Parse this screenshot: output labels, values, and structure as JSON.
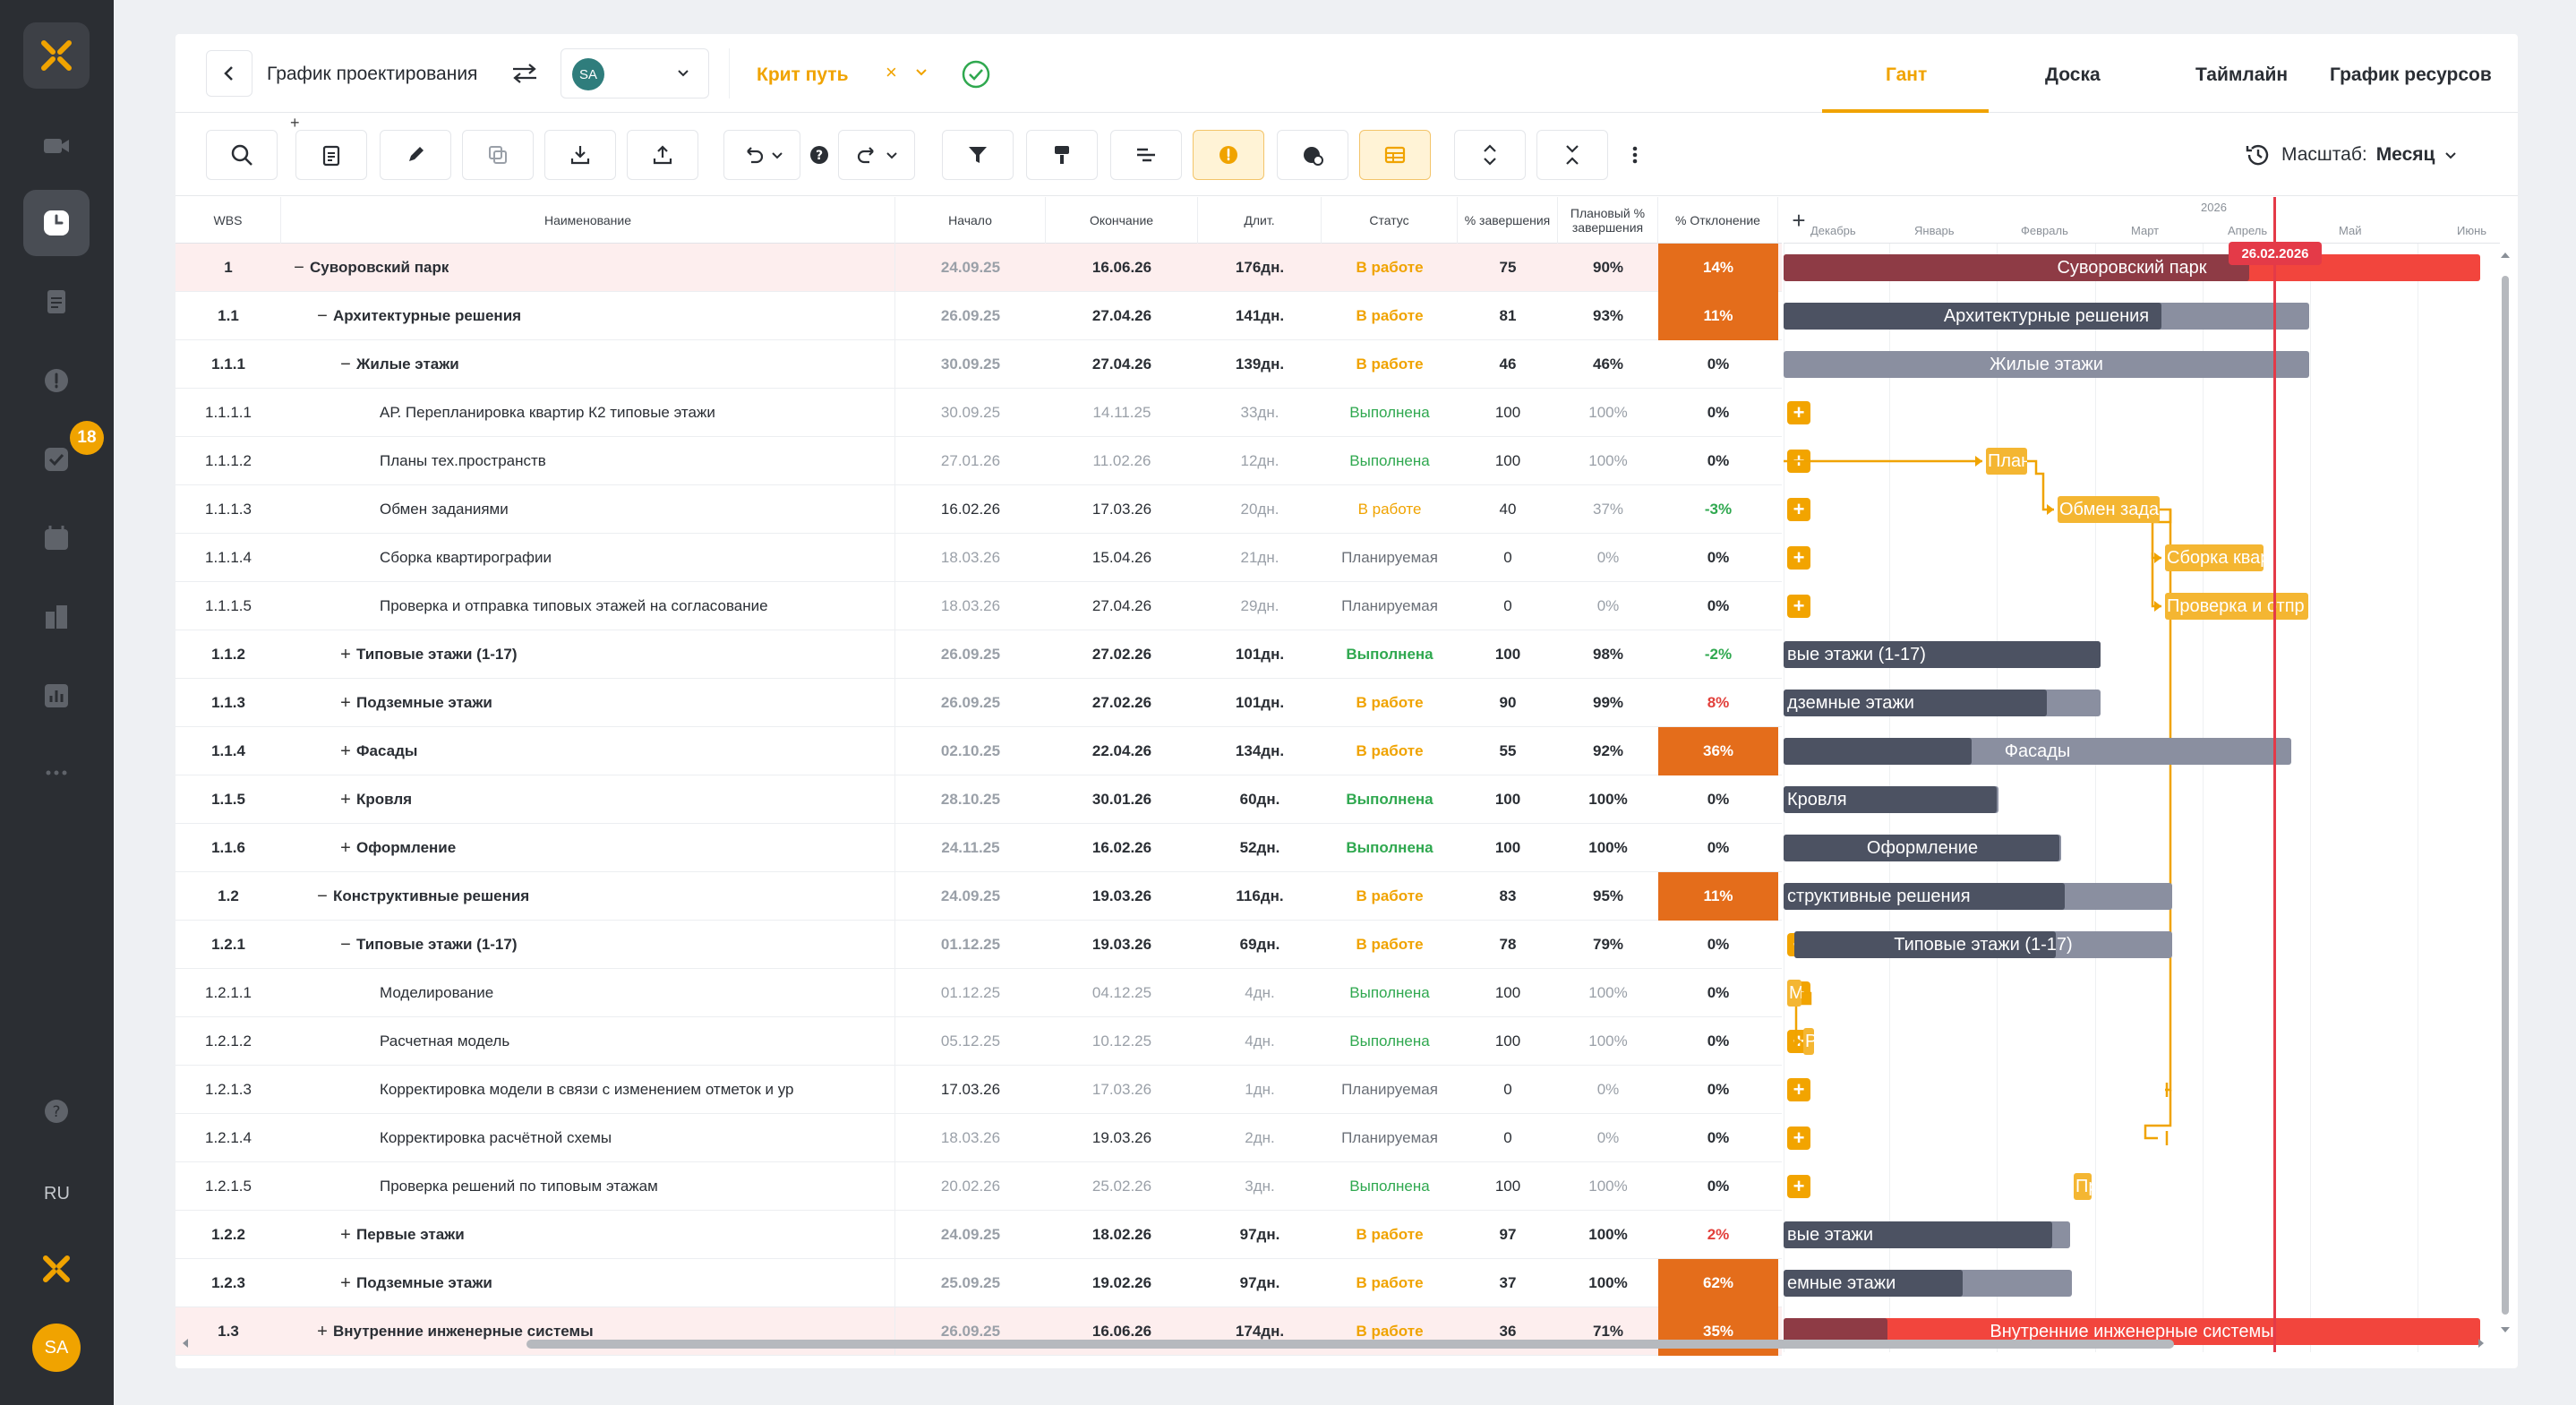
{
  "rail": {
    "lang": "RU",
    "avatar": "SA",
    "badge": "18"
  },
  "header": {
    "title": "График проектирования",
    "user_avatar": "SA",
    "crit_label": "Крит путь",
    "crit_clear": "×",
    "tabs": [
      "Гант",
      "Доска",
      "Таймлайн",
      "График ресурсов"
    ]
  },
  "toolbar": {
    "scale_label": "Масштаб:",
    "scale_value": "Месяц",
    "add_plus": "+"
  },
  "columns": [
    "WBS",
    "Наименование",
    "Начало",
    "Окончание",
    "Длит.",
    "Статус",
    "% завершения",
    "Плановый % завершения",
    "% Отклонение"
  ],
  "gantt_header": {
    "year": "2026",
    "months": [
      "Декабрь",
      "Январь",
      "Февраль",
      "Март",
      "Апрель",
      "Май",
      "Июнь"
    ],
    "today": "26.02.2026"
  },
  "rows": [
    {
      "wbs": "1",
      "name": "Суворовский парк",
      "toggle": "−",
      "start": "24.09.25",
      "end": "16.06.26",
      "dur": "176дн.",
      "status": "В работе",
      "pct": "75",
      "plan": "90%",
      "dev": "14%"
    },
    {
      "wbs": "1.1",
      "name": "Архитектурные решения",
      "toggle": "−",
      "start": "26.09.25",
      "end": "27.04.26",
      "dur": "141дн.",
      "status": "В работе",
      "pct": "81",
      "plan": "93%",
      "dev": "11%"
    },
    {
      "wbs": "1.1.1",
      "name": "Жилые этажи",
      "toggle": "−",
      "start": "30.09.25",
      "end": "27.04.26",
      "dur": "139дн.",
      "status": "В работе",
      "pct": "46",
      "plan": "46%",
      "dev": "0%"
    },
    {
      "wbs": "1.1.1.1",
      "name": "АР. Перепланировка квартир К2 типовые этажи",
      "toggle": "",
      "start": "30.09.25",
      "end": "14.11.25",
      "dur": "33дн.",
      "status": "Выполнена",
      "pct": "100",
      "plan": "100%",
      "dev": "0%"
    },
    {
      "wbs": "1.1.1.2",
      "name": "Планы тех.пространств",
      "toggle": "",
      "start": "27.01.26",
      "end": "11.02.26",
      "dur": "12дн.",
      "status": "Выполнена",
      "pct": "100",
      "plan": "100%",
      "dev": "0%"
    },
    {
      "wbs": "1.1.1.3",
      "name": "Обмен заданиями",
      "toggle": "",
      "start": "16.02.26",
      "end": "17.03.26",
      "dur": "20дн.",
      "status": "В работе",
      "pct": "40",
      "plan": "37%",
      "dev": "-3%"
    },
    {
      "wbs": "1.1.1.4",
      "name": "Сборка квартирографии",
      "toggle": "",
      "start": "18.03.26",
      "end": "15.04.26",
      "dur": "21дн.",
      "status": "Планируемая",
      "pct": "0",
      "plan": "0%",
      "dev": "0%"
    },
    {
      "wbs": "1.1.1.5",
      "name": "Проверка и отправка типовых этажей на согласование",
      "toggle": "",
      "start": "18.03.26",
      "end": "27.04.26",
      "dur": "29дн.",
      "status": "Планируемая",
      "pct": "0",
      "plan": "0%",
      "dev": "0%"
    },
    {
      "wbs": "1.1.2",
      "name": "Типовые этажи (1-17)",
      "toggle": "+",
      "start": "26.09.25",
      "end": "27.02.26",
      "dur": "101дн.",
      "status": "Выполнена",
      "pct": "100",
      "plan": "98%",
      "dev": "-2%"
    },
    {
      "wbs": "1.1.3",
      "name": "Подземные этажи",
      "toggle": "+",
      "start": "26.09.25",
      "end": "27.02.26",
      "dur": "101дн.",
      "status": "В работе",
      "pct": "90",
      "plan": "99%",
      "dev": "8%"
    },
    {
      "wbs": "1.1.4",
      "name": "Фасады",
      "toggle": "+",
      "start": "02.10.25",
      "end": "22.04.26",
      "dur": "134дн.",
      "status": "В работе",
      "pct": "55",
      "plan": "92%",
      "dev": "36%"
    },
    {
      "wbs": "1.1.5",
      "name": "Кровля",
      "toggle": "+",
      "start": "28.10.25",
      "end": "30.01.26",
      "dur": "60дн.",
      "status": "Выполнена",
      "pct": "100",
      "plan": "100%",
      "dev": "0%"
    },
    {
      "wbs": "1.1.6",
      "name": "Оформление",
      "toggle": "+",
      "start": "24.11.25",
      "end": "16.02.26",
      "dur": "52дн.",
      "status": "Выполнена",
      "pct": "100",
      "plan": "100%",
      "dev": "0%"
    },
    {
      "wbs": "1.2",
      "name": "Конструктивные решения",
      "toggle": "−",
      "start": "24.09.25",
      "end": "19.03.26",
      "dur": "116дн.",
      "status": "В работе",
      "pct": "83",
      "plan": "95%",
      "dev": "11%"
    },
    {
      "wbs": "1.2.1",
      "name": "Типовые этажи (1-17)",
      "toggle": "−",
      "start": "01.12.25",
      "end": "19.03.26",
      "dur": "69дн.",
      "status": "В работе",
      "pct": "78",
      "plan": "79%",
      "dev": "0%"
    },
    {
      "wbs": "1.2.1.1",
      "name": "Моделирование",
      "toggle": "",
      "start": "01.12.25",
      "end": "04.12.25",
      "dur": "4дн.",
      "status": "Выполнена",
      "pct": "100",
      "plan": "100%",
      "dev": "0%"
    },
    {
      "wbs": "1.2.1.2",
      "name": "Расчетная модель",
      "toggle": "",
      "start": "05.12.25",
      "end": "10.12.25",
      "dur": "4дн.",
      "status": "Выполнена",
      "pct": "100",
      "plan": "100%",
      "dev": "0%"
    },
    {
      "wbs": "1.2.1.3",
      "name": "Корректировка модели в связи с изменением отметок и ур",
      "toggle": "",
      "start": "17.03.26",
      "end": "17.03.26",
      "dur": "1дн.",
      "status": "Планируемая",
      "pct": "0",
      "plan": "0%",
      "dev": "0%"
    },
    {
      "wbs": "1.2.1.4",
      "name": "Корректировка расчётной схемы",
      "toggle": "",
      "start": "18.03.26",
      "end": "19.03.26",
      "dur": "2дн.",
      "status": "Планируемая",
      "pct": "0",
      "plan": "0%",
      "dev": "0%"
    },
    {
      "wbs": "1.2.1.5",
      "name": "Проверка решений по типовым этажам",
      "toggle": "",
      "start": "20.02.26",
      "end": "25.02.26",
      "dur": "3дн.",
      "status": "Выполнена",
      "pct": "100",
      "plan": "100%",
      "dev": "0%"
    },
    {
      "wbs": "1.2.2",
      "name": "Первые этажи",
      "toggle": "+",
      "start": "24.09.25",
      "end": "18.02.26",
      "dur": "97дн.",
      "status": "В работе",
      "pct": "97",
      "plan": "100%",
      "dev": "2%"
    },
    {
      "wbs": "1.2.3",
      "name": "Подземные этажи",
      "toggle": "+",
      "start": "25.09.25",
      "end": "19.02.26",
      "dur": "97дн.",
      "status": "В работе",
      "pct": "37",
      "plan": "100%",
      "dev": "62%"
    },
    {
      "wbs": "1.3",
      "name": "Внутренние инженерные системы",
      "toggle": "+",
      "start": "26.09.25",
      "end": "16.06.26",
      "dur": "174дн.",
      "status": "В работе",
      "pct": "36",
      "plan": "71%",
      "dev": "35%"
    }
  ],
  "gantt_bars": [
    {
      "label": "Суворовский парк"
    },
    {
      "label": "Архитектурные решения"
    },
    {
      "label": "Жилые этажи"
    },
    {
      "label": ""
    },
    {
      "label": "Планы"
    },
    {
      "label": "Обмен зада"
    },
    {
      "label": "Сборка квар"
    },
    {
      "label": "Проверка и отпр"
    },
    {
      "label": "вые этажи (1-17)"
    },
    {
      "label": "дземные этажи"
    },
    {
      "label": "Фасады"
    },
    {
      "label": "Кровля"
    },
    {
      "label": "Оформление"
    },
    {
      "label": "структивные решения"
    },
    {
      "label": "Типовые этажи (1-17)"
    },
    {
      "label": "М"
    },
    {
      "label": "Ра"
    },
    {
      "label": ""
    },
    {
      "label": ""
    },
    {
      "label": "Пр"
    },
    {
      "label": "вые этажи"
    },
    {
      "label": "емные этажи"
    },
    {
      "label": "Внутренние инженерные системы"
    }
  ],
  "colors": {
    "accent": "#f0a300",
    "hot": "#e46d1b",
    "today": "#e43a48",
    "bar_dark": "#4c5262",
    "bar_light": "#8a8fa0",
    "bar_red": "#f2453d"
  }
}
